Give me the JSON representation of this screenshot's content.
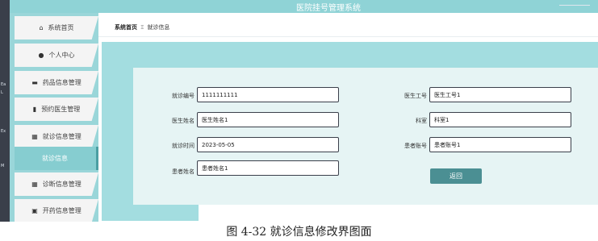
{
  "window": {
    "title": "医院挂号管理系统"
  },
  "desktop": {
    "labels": [
      "Ea",
      "L",
      "Ex",
      "M"
    ]
  },
  "sidebar": {
    "items": [
      {
        "icon": "home-icon",
        "glyph": "⌂",
        "label": "系统首页"
      },
      {
        "icon": "user-icon",
        "glyph": "●",
        "label": "个人中心"
      },
      {
        "icon": "medicine-icon",
        "glyph": "▬",
        "label": "药品信息管理"
      },
      {
        "icon": "doctor-icon",
        "glyph": "▮",
        "label": "预约医生管理"
      },
      {
        "icon": "grid-icon",
        "glyph": "▦",
        "label": "就诊信息管理"
      },
      {
        "icon": "",
        "glyph": "",
        "label": "就诊信息"
      },
      {
        "icon": "grid-icon",
        "glyph": "▦",
        "label": "诊断信息管理"
      },
      {
        "icon": "prescription-icon",
        "glyph": "▣",
        "label": "开药信息管理"
      }
    ]
  },
  "breadcrumb": {
    "home": "系统首页",
    "separator": "Ξ",
    "current": "就诊信息"
  },
  "form": {
    "visit_no": {
      "label": "就诊编号",
      "value": "1111111111"
    },
    "doctor_name": {
      "label": "医生姓名",
      "value": "医生姓名1"
    },
    "visit_time": {
      "label": "就诊时间",
      "value": "2023-05-05"
    },
    "patient_name": {
      "label": "患者姓名",
      "value": "患者姓名1"
    },
    "doctor_no": {
      "label": "医生工号",
      "value": "医生工号1"
    },
    "department": {
      "label": "科室",
      "value": "科室1"
    },
    "patient_account": {
      "label": "患者账号",
      "value": "患者账号1"
    },
    "back_label": "返回"
  },
  "caption": "图 4-32 就诊信息修改界图面",
  "colors": {
    "accent": "#4b8f93",
    "sidebar": "#9ad6d9",
    "panel": "#e6f4f4",
    "header": "#8fd3d6"
  }
}
